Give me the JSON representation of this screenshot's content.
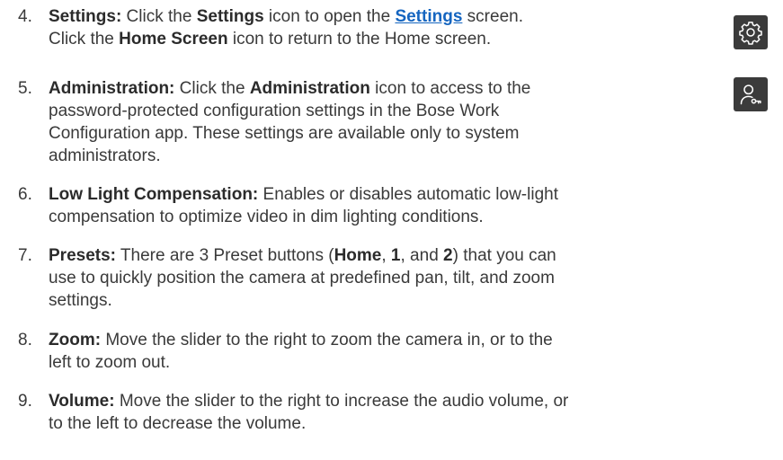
{
  "items": [
    {
      "number": "4.",
      "title": "Settings:",
      "text_a": " Click the ",
      "bold_a": "Settings",
      "text_b": " icon to open the ",
      "link": "Settings",
      "text_c": " screen.",
      "line2_text_a": "Click the ",
      "line2_bold": "Home Screen",
      "line2_text_b": " icon to return to the Home screen."
    },
    {
      "number": "5.",
      "title": "Administration:",
      "text_a": " Click the ",
      "bold_a": "Administration",
      "text_b": " icon to access to the",
      "line2": "password-protected configuration settings in the Bose Work",
      "line3": "Configuration app. These settings are available only to system",
      "line4": "administrators."
    },
    {
      "number": "6.",
      "title": "Low Light Compensation:",
      "text_a": " Enables or disables automatic low-light",
      "line2": "compensation to optimize video in dim lighting conditions."
    },
    {
      "number": "7.",
      "title": "Presets:",
      "text_a": " There are 3 Preset buttons (",
      "bold_home": "Home",
      "sep1": ", ",
      "bold_1": "1",
      "sep2": ", and ",
      "bold_2": "2",
      "text_b": ") that you can",
      "line2": "use to quickly position the camera at predefined pan, tilt, and zoom",
      "line3": "settings."
    },
    {
      "number": "8.",
      "title": "Zoom:",
      "text_a": " Move the slider to the right to zoom the camera in, or to the",
      "line2": "left to zoom out."
    },
    {
      "number": "9.",
      "title": "Volume:",
      "text_a": " Move the slider to the right to increase the audio volume, or",
      "line2": "to the left to decrease the volume."
    }
  ],
  "icons": {
    "settings": "gear-icon",
    "administration": "user-key-icon",
    "background": "#3b3b3b",
    "stroke": "#ffffff"
  },
  "colors": {
    "text": "#3a3a3a",
    "link": "#1565c0"
  }
}
